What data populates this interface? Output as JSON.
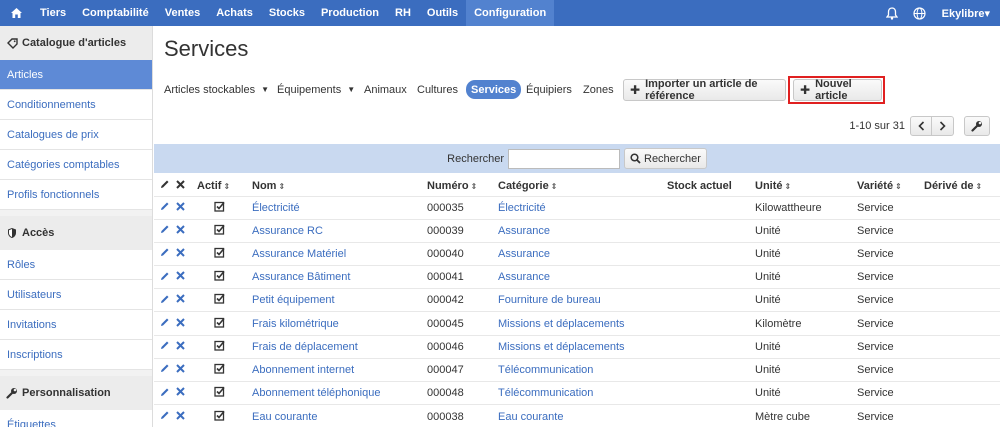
{
  "topnav": {
    "items": [
      "Tiers",
      "Comptabilité",
      "Ventes",
      "Achats",
      "Stocks",
      "Production",
      "RH",
      "Outils",
      "Configuration"
    ],
    "active": "Configuration",
    "user": "Ekylibre▾"
  },
  "sidebar": {
    "sections": [
      {
        "title": "Catalogue d'articles",
        "icon": "tag-icon",
        "items": [
          "Articles",
          "Conditionnements",
          "Catalogues de prix",
          "Catégories comptables",
          "Profils fonctionnels"
        ]
      },
      {
        "title": "Accès",
        "icon": "shield-icon",
        "items": [
          "Rôles",
          "Utilisateurs",
          "Invitations",
          "Inscriptions"
        ]
      },
      {
        "title": "Personnalisation",
        "icon": "wrench-icon",
        "items": [
          "Étiquettes"
        ]
      }
    ],
    "active_item": "Articles"
  },
  "page": {
    "title": "Services"
  },
  "toolbar": {
    "filters": [
      "Articles stockables",
      "Équipements",
      "Animaux",
      "Cultures",
      "Services",
      "Équipiers",
      "Zones"
    ],
    "active_filter": "Services",
    "import_label": "Importer un article de référence",
    "new_label": "Nouvel article"
  },
  "pager": {
    "count": "1-10 sur 31"
  },
  "search": {
    "label": "Rechercher",
    "button": "Rechercher",
    "value": ""
  },
  "table": {
    "headers": {
      "active": "Actif",
      "name": "Nom",
      "number": "Numéro",
      "category": "Catégorie",
      "stock": "Stock actuel",
      "unit": "Unité",
      "variety": "Variété",
      "derived": "Dérivé de"
    },
    "rows": [
      {
        "name": "Électricité",
        "number": "000035",
        "category": "Électricité",
        "unit": "Kilowattheure",
        "variety": "Service"
      },
      {
        "name": "Assurance RC",
        "number": "000039",
        "category": "Assurance",
        "unit": "Unité",
        "variety": "Service"
      },
      {
        "name": "Assurance Matériel",
        "number": "000040",
        "category": "Assurance",
        "unit": "Unité",
        "variety": "Service"
      },
      {
        "name": "Assurance Bâtiment",
        "number": "000041",
        "category": "Assurance",
        "unit": "Unité",
        "variety": "Service"
      },
      {
        "name": "Petit équipement",
        "number": "000042",
        "category": "Fourniture de bureau",
        "unit": "Unité",
        "variety": "Service"
      },
      {
        "name": "Frais kilométrique",
        "number": "000045",
        "category": "Missions et déplacements",
        "unit": "Kilomètre",
        "variety": "Service"
      },
      {
        "name": "Frais de déplacement",
        "number": "000046",
        "category": "Missions et déplacements",
        "unit": "Unité",
        "variety": "Service"
      },
      {
        "name": "Abonnement internet",
        "number": "000047",
        "category": "Télécommunication",
        "unit": "Unité",
        "variety": "Service"
      },
      {
        "name": "Abonnement téléphonique",
        "number": "000048",
        "category": "Télécommunication",
        "unit": "Unité",
        "variety": "Service"
      },
      {
        "name": "Eau courante",
        "number": "000038",
        "category": "Eau courante",
        "unit": "Mètre cube",
        "variety": "Service"
      }
    ]
  },
  "colors": {
    "accent": "#3b6dbf",
    "highlight": "#e02020",
    "search_bar": "#c9d9f0"
  }
}
